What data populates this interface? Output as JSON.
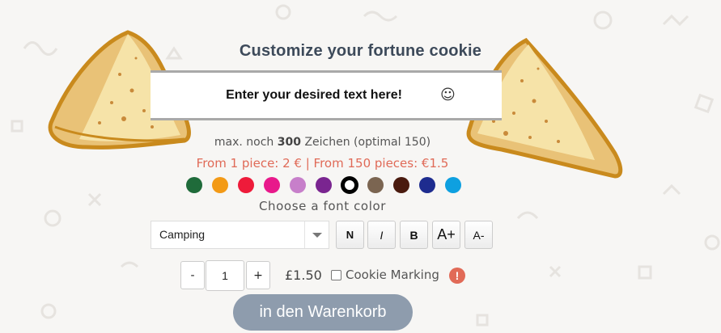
{
  "title": "Customize your fortune cookie",
  "text_input": {
    "placeholder": "Enter your desired text here!",
    "value": ""
  },
  "char_info": {
    "prefix": "max. noch",
    "count": "300",
    "suffix": "Zeichen (optimal 150)"
  },
  "price_line": "From 1 piece: 2 € | From 150 pieces: €1.5",
  "font_colors": [
    {
      "name": "dark-green",
      "hex": "#1f6b3a"
    },
    {
      "name": "orange",
      "hex": "#f39a16"
    },
    {
      "name": "red",
      "hex": "#ee1b3a"
    },
    {
      "name": "magenta",
      "hex": "#e8198b"
    },
    {
      "name": "lilac",
      "hex": "#c77fca"
    },
    {
      "name": "purple",
      "hex": "#7a2590"
    },
    {
      "name": "black",
      "hex": "#000000",
      "selected": true
    },
    {
      "name": "taupe",
      "hex": "#7b6551"
    },
    {
      "name": "dark-brown",
      "hex": "#4a1a0e"
    },
    {
      "name": "navy",
      "hex": "#1e2c8f"
    },
    {
      "name": "sky-blue",
      "hex": "#0ea0e0"
    }
  ],
  "color_label": "Choose a font color",
  "font_select": {
    "value": "Camping"
  },
  "format_buttons": {
    "normal": "N",
    "italic": "I",
    "bold": "B",
    "size_up": "A+",
    "size_down": "A-"
  },
  "quantity": {
    "minus": "-",
    "value": "1",
    "plus": "+"
  },
  "unit_price": "£1.50",
  "cookie_marking_label": "Cookie Marking",
  "warning_glyph": "!",
  "cart_button": "in den Warenkorb",
  "colors": {
    "accent": "#e06a57",
    "cart": "#8e9cad",
    "title": "#3d4a5a"
  }
}
